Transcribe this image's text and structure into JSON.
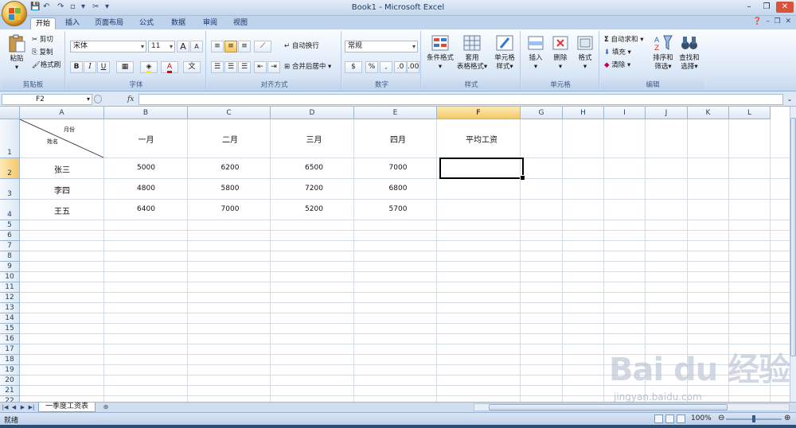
{
  "title": "Book1 - Microsoft Excel",
  "tabs": [
    "开始",
    "插入",
    "页面布局",
    "公式",
    "数据",
    "审阅",
    "视图"
  ],
  "ribbon": {
    "clipboard": {
      "paste": "粘贴",
      "cut": "剪切",
      "copy": "复制",
      "format_painter": "格式刷",
      "label": "剪贴板"
    },
    "font": {
      "name": "宋体",
      "size": "11",
      "bold": "B",
      "italic": "I",
      "underline": "U",
      "grow": "A",
      "shrink": "A",
      "font_color": "A",
      "label": "字体"
    },
    "alignment": {
      "wrap": "自动换行",
      "merge": "合并后居中",
      "label": "对齐方式"
    },
    "number": {
      "format": "常规",
      "percent": "%",
      "comma": ",",
      "label": "数字"
    },
    "styles": {
      "conditional": "条件格式",
      "table1": "套用",
      "table2": "表格格式",
      "cell1": "单元格",
      "cell2": "样式",
      "label": "样式"
    },
    "cells": {
      "insert": "插入",
      "delete": "删除",
      "format": "格式",
      "label": "单元格"
    },
    "editing": {
      "sum": "自动求和",
      "fill": "填充",
      "clear": "清除",
      "sort1": "排序和",
      "sort2": "筛选",
      "find1": "查找和",
      "find2": "选择",
      "label": "编辑"
    }
  },
  "formula_bar": {
    "name_box": "F2",
    "fx": "fx",
    "value": ""
  },
  "columns": [
    "A",
    "B",
    "C",
    "D",
    "E",
    "F",
    "G",
    "H",
    "I",
    "J",
    "K",
    "L"
  ],
  "rows": [
    "1",
    "2",
    "3",
    "4",
    "5",
    "6",
    "7",
    "8",
    "9",
    "10",
    "11",
    "12",
    "13",
    "14",
    "15",
    "16",
    "17",
    "18",
    "19",
    "20",
    "21",
    "22"
  ],
  "active_cell": "F2",
  "sheet": {
    "a1_top": "月份",
    "a1_bottom": "姓名",
    "headers": [
      "一月",
      "二月",
      "三月",
      "四月",
      "平均工资"
    ],
    "data": [
      {
        "name": "张三",
        "values": [
          "5000",
          "6200",
          "6500",
          "7000"
        ]
      },
      {
        "name": "李四",
        "values": [
          "4800",
          "5800",
          "7200",
          "6800"
        ]
      },
      {
        "name": "王五",
        "values": [
          "6400",
          "7000",
          "5200",
          "5700"
        ]
      }
    ]
  },
  "sheet_tab": "一季度工资表",
  "status": {
    "text": "就绪",
    "zoom": "100%"
  },
  "watermark": {
    "logo": "Bai du 经验",
    "url": "jingyan.baidu.com"
  }
}
